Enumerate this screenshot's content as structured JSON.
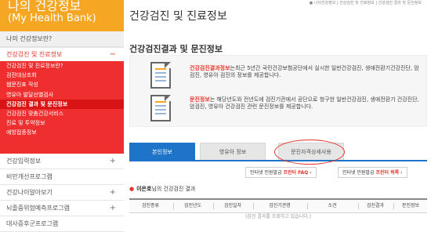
{
  "brand": {
    "line1": "나의 건강정보",
    "line2": "(My Health Bank)"
  },
  "breadcrumb": "● 나의건강정보 | 건강검진 및 진료정보 | 건강검진 결과 및 문진정보",
  "sidebar": {
    "top_item": "나의 건강정보란?",
    "active_section": "건강검진 및 진료정보",
    "active_sign": "−",
    "submenu": [
      "건강검진 및 진료정보란?",
      "검진대상조회",
      "웹문진표 작성",
      "영유아 발달선별검사",
      "건강검진 결과 및 문진정보",
      "건강검진 맞춤건강서비스",
      "진료 및 투약정보",
      "예방접종정보"
    ],
    "items": [
      {
        "label": "건강입력정보",
        "sign": "+"
      },
      {
        "label": "비만개선프로그램",
        "sign": ""
      },
      {
        "label": "건강나이알아보기",
        "sign": "+"
      },
      {
        "label": "뇌졸중위험예측프로그램",
        "sign": "+"
      },
      {
        "label": "대사증후군프로그램",
        "sign": ""
      }
    ]
  },
  "page_title": "건강검진 및 진료정보",
  "section_title": "건강검진결과 및 문진정보",
  "info": {
    "p1_highlight": "건강검진결과정보",
    "p1_text": "는최근 5년간 국민건강보험공단에서 실시한 일반건강검진, 생애전환기건강진단, 암 검진, 영유아 검진의 정보를 제공합니다.",
    "p2_highlight": "문진정보",
    "p2_text": "는 해당년도와 전년도에 검진기관에서 공단으로 청구한 일반건강검진, 생애전환기 건강진단, 암검진, 영유아 건강검진 관련 문진정보를 제공합니다."
  },
  "tabs": [
    {
      "label": "본인정보",
      "active": true
    },
    {
      "label": "영유아 정보",
      "active": false
    },
    {
      "label": "문진자격상세사용",
      "active": false
    }
  ],
  "buttons": {
    "faq_prefix": "인터넷 민원발급 ",
    "faq_bold": "프린터 FAQ",
    "faq_arrow": "›",
    "list_prefix": "인터넷 민원발급 ",
    "list_bold": "프린터 목록",
    "list_arrow": "›"
  },
  "result": {
    "bullet": "●",
    "name": "이은호",
    "suffix": "님의 건강검진 결과"
  },
  "table": {
    "headers": [
      "검진종류",
      "검진년도",
      "검진일자",
      "검진기관명",
      "소견",
      "검진결과",
      "문진정보"
    ],
    "row_text": "(검진 결과를 조회하고 있습니다.)"
  },
  "colors": {
    "brand": "#f5a623",
    "submenu_bg": "#ef2f2f",
    "accent_red": "#e8352a",
    "tab_blue": "#1d74c8"
  }
}
